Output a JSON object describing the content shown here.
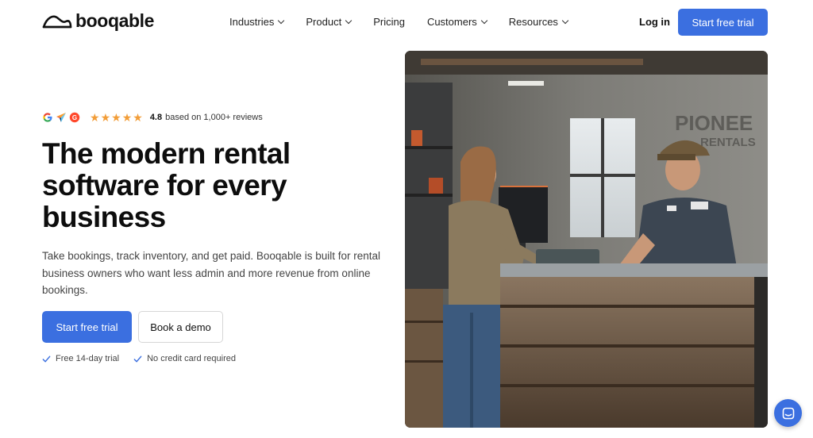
{
  "header": {
    "logo_text": "booqable",
    "nav": [
      {
        "label": "Industries",
        "dropdown": true
      },
      {
        "label": "Product",
        "dropdown": true
      },
      {
        "label": "Pricing",
        "dropdown": false
      },
      {
        "label": "Customers",
        "dropdown": true
      },
      {
        "label": "Resources",
        "dropdown": true
      }
    ],
    "login_label": "Log in",
    "cta_label": "Start free trial"
  },
  "rating": {
    "platforms": [
      "google-icon",
      "capterra-icon",
      "g2-icon"
    ],
    "stars": 5,
    "score": "4.8",
    "text": "based on 1,000+ reviews"
  },
  "hero": {
    "headline": "The modern rental software for every business",
    "subtext": "Take bookings, track inventory, and get paid. Booqable is built for rental business owners who want less admin and more revenue from online bookings.",
    "primary_cta": "Start free trial",
    "secondary_cta": "Book a demo",
    "checks": [
      "Free 14-day trial",
      "No credit card required"
    ]
  },
  "photo": {
    "sign_text": "PIONEE",
    "sign_subtext": "RENTALS"
  },
  "colors": {
    "brand": "#3b6fe0",
    "star": "#f29d38",
    "text": "#111111"
  }
}
